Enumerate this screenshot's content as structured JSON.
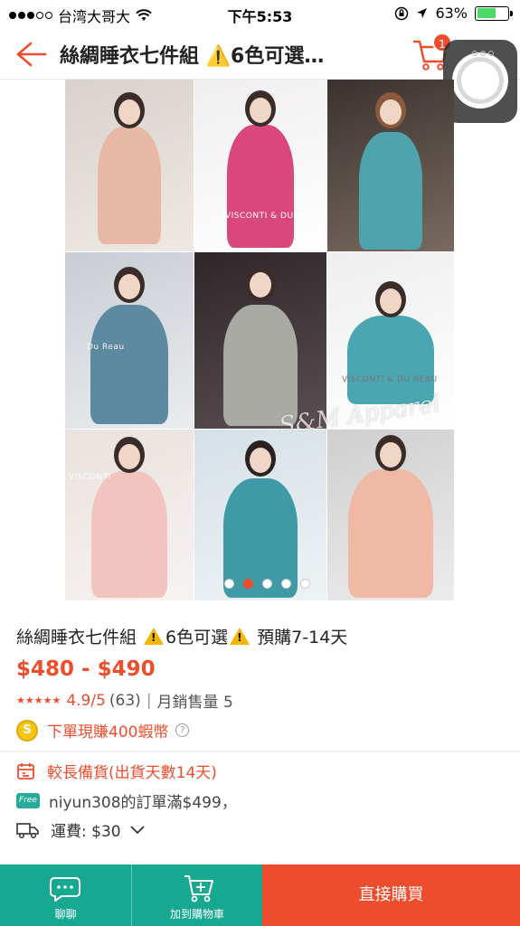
{
  "status_bar": {
    "carrier": "台湾大哥大",
    "time": "下午5:53",
    "battery_percent": "63%",
    "battery_level": 0.63
  },
  "header": {
    "title": "絲綢睡衣七件組 ⚠️6色可選…",
    "cart_count": "1"
  },
  "product_image": {
    "watermark": "S&M Apparel",
    "tile_texts": [
      "VISCONTI & DU REAU",
      "Du Reau",
      "VISCONTI & DU REAU",
      "VISCONTI"
    ],
    "carousel_dot_count": 5,
    "active_dot_index": 1
  },
  "product": {
    "title_part1": "絲綢睡衣七件組 ",
    "title_part2": "6色可選",
    "title_part3": " 預購7-14天",
    "price": "$480 - $490",
    "rating_value": "4.9/5",
    "rating_count": "(63)",
    "separator": "|",
    "monthly_sales": "月銷售量 5",
    "coin_icon_text": "S",
    "coin_text": "下單現賺400蝦幣",
    "help_icon_text": "?"
  },
  "shipping": {
    "preorder_text": "較長備貨(出貨天數14天)",
    "free_badge": "Free",
    "free_shipping_text": "niyun308的訂單滿$499，",
    "fee_text": "運費: $30"
  },
  "bottom_bar": {
    "chat_label": "聊聊",
    "add_to_cart_label": "加到購物車",
    "buy_now_label": "直接購買"
  },
  "colors": {
    "accent": "#ee4d2d",
    "teal": "#16a890"
  }
}
